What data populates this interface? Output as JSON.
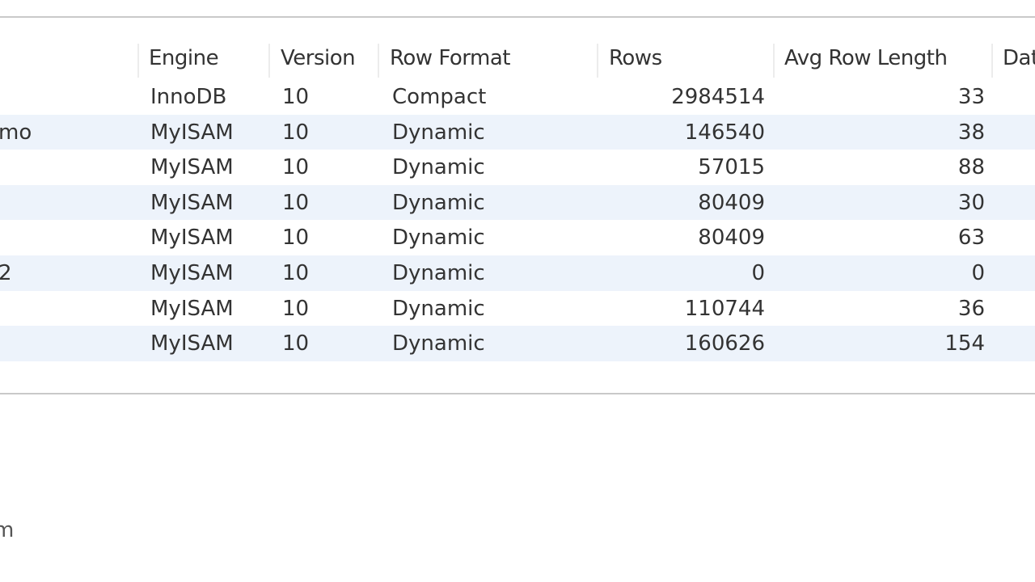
{
  "table": {
    "columns": [
      "Engine",
      "Version",
      "Row Format",
      "Rows",
      "Avg Row Length",
      "Dat"
    ],
    "rows": [
      {
        "name": "",
        "engine": "InnoDB",
        "version": "10",
        "row_format": "Compact",
        "rows": "2984514",
        "avg_row_length": "33"
      },
      {
        "name": "mo",
        "engine": "MyISAM",
        "version": "10",
        "row_format": "Dynamic",
        "rows": "146540",
        "avg_row_length": "38"
      },
      {
        "name": "",
        "engine": "MyISAM",
        "version": "10",
        "row_format": "Dynamic",
        "rows": "57015",
        "avg_row_length": "88"
      },
      {
        "name": "",
        "engine": "MyISAM",
        "version": "10",
        "row_format": "Dynamic",
        "rows": "80409",
        "avg_row_length": "30"
      },
      {
        "name": "",
        "engine": "MyISAM",
        "version": "10",
        "row_format": "Dynamic",
        "rows": "80409",
        "avg_row_length": "63"
      },
      {
        "name": "2",
        "engine": "MyISAM",
        "version": "10",
        "row_format": "Dynamic",
        "rows": "0",
        "avg_row_length": "0"
      },
      {
        "name": "",
        "engine": "MyISAM",
        "version": "10",
        "row_format": "Dynamic",
        "rows": "110744",
        "avg_row_length": "36"
      },
      {
        "name": "",
        "engine": "MyISAM",
        "version": "10",
        "row_format": "Dynamic",
        "rows": "160626",
        "avg_row_length": "154"
      }
    ]
  },
  "footer": {
    "text": "m"
  },
  "colors": {
    "alt_row": "#edf3fb",
    "divider": "#c9c9c9"
  }
}
